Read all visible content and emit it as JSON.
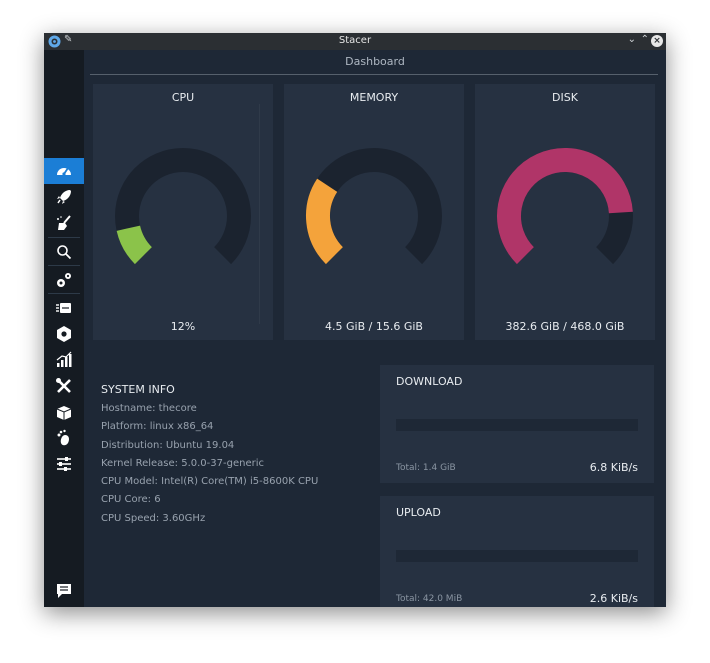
{
  "window": {
    "title": "Stacer"
  },
  "page": {
    "title": "Dashboard"
  },
  "sidebar": {
    "items": [
      {
        "name": "dashboard",
        "icon": "speedometer-icon",
        "active": true
      },
      {
        "name": "startup-apps",
        "icon": "rocket-icon"
      },
      {
        "name": "system-cleaner",
        "icon": "broom-icon"
      },
      {
        "name": "search",
        "icon": "search-icon"
      },
      {
        "name": "services",
        "icon": "gears-icon"
      },
      {
        "name": "processes",
        "icon": "processes-icon"
      },
      {
        "name": "uninstaller",
        "icon": "package-icon"
      },
      {
        "name": "resources",
        "icon": "chart-icon"
      },
      {
        "name": "helpers",
        "icon": "tools-icon"
      },
      {
        "name": "apt-repository",
        "icon": "box-icon"
      },
      {
        "name": "gnome-settings",
        "icon": "gnome-foot-icon"
      },
      {
        "name": "settings",
        "icon": "sliders-icon"
      }
    ],
    "feedback_icon": "feedback-icon"
  },
  "gauges": {
    "cpu": {
      "title": "CPU",
      "value": "12%",
      "percent": 0.12,
      "color": "#8bc34a"
    },
    "memory": {
      "title": "MEMORY",
      "value": "4.5 GiB / 15.6 GiB",
      "percent": 0.29,
      "color": "#f4a33b"
    },
    "disk": {
      "title": "DISK",
      "value": "382.6 GiB / 468.0 GiB",
      "percent": 0.82,
      "color": "#b03568"
    },
    "track_color": "#1b232f"
  },
  "system_info": {
    "title": "SYSTEM INFO",
    "lines": [
      "Hostname: thecore",
      "Platform: linux x86_64",
      "Distribution: Ubuntu 19.04",
      "Kernel Release: 5.0.0-37-generic",
      "CPU Model: Intel(R) Core(TM) i5-8600K CPU",
      "CPU Core: 6",
      "CPU Speed: 3.60GHz"
    ]
  },
  "download": {
    "title": "DOWNLOAD",
    "total": "Total: 1.4 GiB",
    "speed": "6.8 KiB/s"
  },
  "upload": {
    "title": "UPLOAD",
    "total": "Total: 42.0 MiB",
    "speed": "2.6 KiB/s"
  }
}
